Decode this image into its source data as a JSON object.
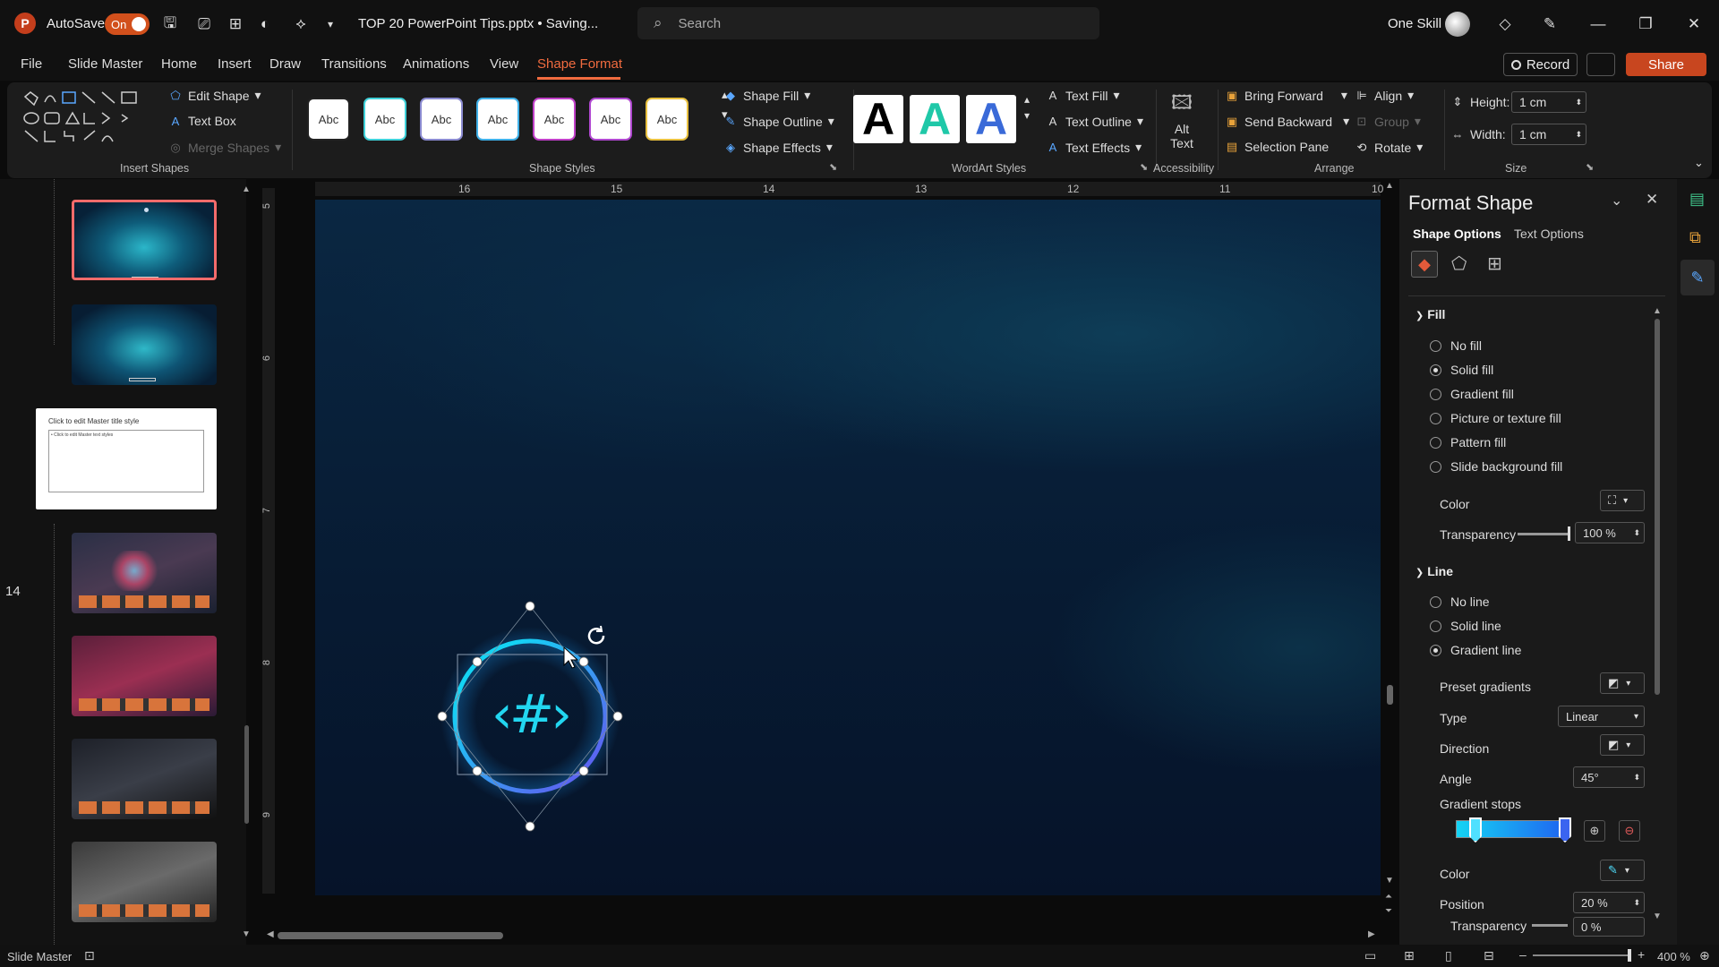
{
  "titlebar": {
    "autosave_label": "AutoSave",
    "autosave_state": "On",
    "document_title": "TOP 20 PowerPoint Tips.pptx • Saving...",
    "search_placeholder": "Search",
    "user_name": "One Skill"
  },
  "menu": {
    "file": "File",
    "slide_master": "Slide Master",
    "home": "Home",
    "insert": "Insert",
    "draw": "Draw",
    "transitions": "Transitions",
    "animations": "Animations",
    "view": "View",
    "shape_format": "Shape Format",
    "record": "Record",
    "share": "Share"
  },
  "ribbon": {
    "insert_shapes": {
      "label": "Insert Shapes",
      "edit_shape": "Edit Shape",
      "text_box": "Text Box",
      "merge_shapes": "Merge Shapes"
    },
    "shape_styles": {
      "label": "Shape Styles",
      "swatches": [
        "Abc",
        "Abc",
        "Abc",
        "Abc",
        "Abc",
        "Abc",
        "Abc"
      ],
      "swatch_colors": [
        "#222222",
        "#3fd0d8",
        "#8a8ad0",
        "#3fb0e8",
        "#c040c8",
        "#b048d0",
        "#e8c040"
      ],
      "shape_fill": "Shape Fill",
      "shape_outline": "Shape Outline",
      "shape_effects": "Shape Effects"
    },
    "wordart_styles": {
      "label": "WordArt Styles",
      "letters": [
        "A",
        "A",
        "A"
      ],
      "colors": [
        "#000000",
        "#1fc8a8",
        "#3a6ad8"
      ],
      "text_fill": "Text Fill",
      "text_outline": "Text Outline",
      "text_effects": "Text Effects"
    },
    "accessibility": {
      "label": "Accessibility",
      "alt_text_1": "Alt",
      "alt_text_2": "Text"
    },
    "arrange": {
      "label": "Arrange",
      "bring_forward": "Bring Forward",
      "send_backward": "Send Backward",
      "selection_pane": "Selection Pane",
      "align": "Align",
      "group": "Group",
      "rotate": "Rotate"
    },
    "size": {
      "label": "Size",
      "height_label": "Height:",
      "height_value": "1 cm",
      "width_label": "Width:",
      "width_value": "1 cm"
    }
  },
  "slides": {
    "slide_number": "14",
    "master_title": "Click to edit Master title style",
    "master_text": "• Click to edit Master text styles"
  },
  "ruler": {
    "h_numbers": [
      "16",
      "15",
      "14",
      "13",
      "12",
      "11",
      "10"
    ],
    "v_numbers": [
      "5",
      "6",
      "7",
      "8",
      "9"
    ]
  },
  "slide": {
    "symbol": "‹#›"
  },
  "format_pane": {
    "title": "Format Shape",
    "tab_shape": "Shape Options",
    "tab_text": "Text Options",
    "fill": {
      "header": "Fill",
      "options": [
        "No fill",
        "Solid fill",
        "Gradient fill",
        "Picture or texture fill",
        "Pattern fill",
        "Slide background fill"
      ],
      "selected": "Solid fill",
      "color_label": "Color",
      "transparency_label": "Transparency",
      "transparency_value": "100 %"
    },
    "line": {
      "header": "Line",
      "options": [
        "No line",
        "Solid line",
        "Gradient line"
      ],
      "selected": "Gradient line",
      "preset_label": "Preset gradients",
      "type_label": "Type",
      "type_value": "Linear",
      "direction_label": "Direction",
      "angle_label": "Angle",
      "angle_value": "45°",
      "stops_label": "Gradient stops",
      "color_label": "Color",
      "position_label": "Position",
      "position_value": "20 %",
      "transparency_label": "Transparency",
      "transparency_value": "0 %"
    }
  },
  "status": {
    "view": "Slide Master",
    "zoom": "400 %"
  },
  "colors": {
    "accent": "#f06b3f",
    "selection": "#f26b6b",
    "circle_start": "#14d4f4",
    "circle_end": "#6a4cf0"
  }
}
